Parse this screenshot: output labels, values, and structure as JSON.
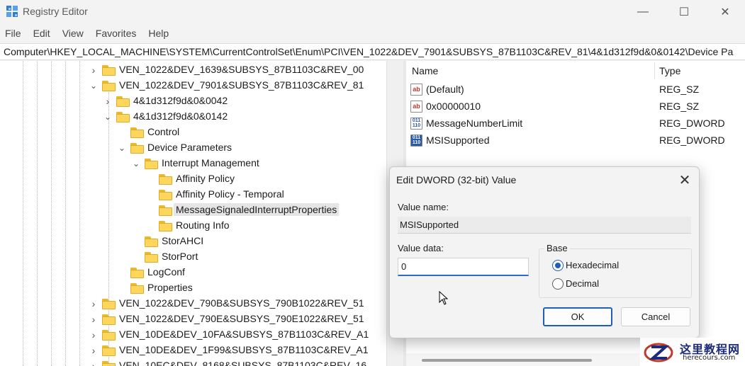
{
  "window": {
    "title": "Registry Editor",
    "controls": {
      "minimize": "—",
      "maximize": "☐",
      "close": "✕"
    }
  },
  "menu": {
    "items": [
      "File",
      "Edit",
      "View",
      "Favorites",
      "Help"
    ]
  },
  "address": "Computer\\HKEY_LOCAL_MACHINE\\SYSTEM\\CurrentControlSet\\Enum\\PCI\\VEN_1022&DEV_7901&SUBSYS_87B1103C&REV_81\\4&1d312f9d&0&0142\\Device Pa",
  "tree": {
    "items": [
      {
        "label": "VEN_1022&DEV_1639&SUBSYS_87B1103C&REV_00",
        "chevron": "›",
        "level": 0
      },
      {
        "label": "VEN_1022&DEV_7901&SUBSYS_87B1103C&REV_81",
        "chevron": "⌄",
        "level": 0
      },
      {
        "label": "4&1d312f9d&0&0042",
        "chevron": "›",
        "level": 1
      },
      {
        "label": "4&1d312f9d&0&0142",
        "chevron": "⌄",
        "level": 1
      },
      {
        "label": "Control",
        "chevron": "",
        "level": 2
      },
      {
        "label": "Device Parameters",
        "chevron": "⌄",
        "level": 2
      },
      {
        "label": "Interrupt Management",
        "chevron": "⌄",
        "level": 3
      },
      {
        "label": "Affinity Policy",
        "chevron": "",
        "level": 4
      },
      {
        "label": "Affinity Policy - Temporal",
        "chevron": "",
        "level": 4
      },
      {
        "label": "MessageSignaledInterruptProperties",
        "chevron": "",
        "level": 4,
        "selected": true
      },
      {
        "label": "Routing Info",
        "chevron": "",
        "level": 4
      },
      {
        "label": "StorAHCI",
        "chevron": "",
        "level": 3
      },
      {
        "label": "StorPort",
        "chevron": "",
        "level": 3
      },
      {
        "label": "LogConf",
        "chevron": "",
        "level": 2
      },
      {
        "label": "Properties",
        "chevron": "",
        "level": 2
      },
      {
        "label": "VEN_1022&DEV_790B&SUBSYS_790B1022&REV_51",
        "chevron": "›",
        "level": 0
      },
      {
        "label": "VEN_1022&DEV_790E&SUBSYS_790E1022&REV_51",
        "chevron": "›",
        "level": 0
      },
      {
        "label": "VEN_10DE&DEV_10FA&SUBSYS_87B1103C&REV_A1",
        "chevron": "›",
        "level": 0
      },
      {
        "label": "VEN_10DE&DEV_1F99&SUBSYS_87B1103C&REV_A1",
        "chevron": "›",
        "level": 0
      },
      {
        "label": "VEN_10EC&DEV_8168&SUBSYS_87B1103C&REV_16",
        "chevron": "›",
        "level": 0
      }
    ]
  },
  "values": {
    "headers": {
      "name": "Name",
      "type": "Type"
    },
    "rows": [
      {
        "name": "(Default)",
        "type": "REG_SZ",
        "icon": "string-value-icon",
        "glyph": "ab"
      },
      {
        "name": "0x00000010",
        "type": "REG_SZ",
        "icon": "string-value-icon",
        "glyph": "ab"
      },
      {
        "name": "MessageNumberLimit",
        "type": "REG_DWORD",
        "icon": "dword-value-icon",
        "glyph": "011\n110"
      },
      {
        "name": "MSISupported",
        "type": "REG_DWORD",
        "icon": "dword-value-icon",
        "glyph": "011\n110"
      }
    ]
  },
  "dialog": {
    "title": "Edit DWORD (32-bit) Value",
    "close": "✕",
    "value_name_label": "Value name:",
    "value_name": "MSISupported",
    "value_data_label": "Value data:",
    "value_data": "0",
    "base_label": "Base",
    "hex_label": "Hexadecimal",
    "dec_label": "Decimal",
    "ok": "OK",
    "cancel": "Cancel"
  },
  "watermark": {
    "text": "这里教程网",
    "sub": "herecours.com"
  },
  "colors": {
    "folder": "#ffd65c",
    "accent": "#1f5fb8",
    "selected_row": "#e5e5e5"
  }
}
